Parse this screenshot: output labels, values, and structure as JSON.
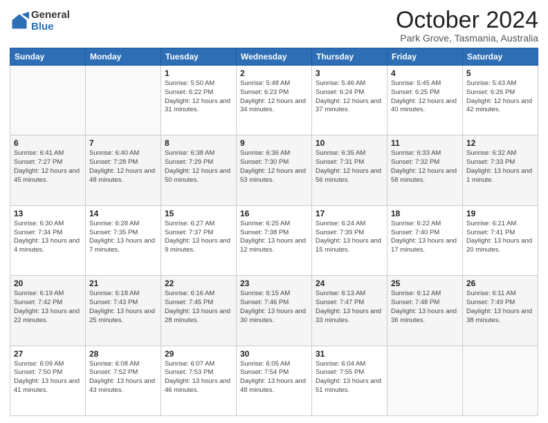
{
  "logo": {
    "general": "General",
    "blue": "Blue"
  },
  "header": {
    "month": "October 2024",
    "location": "Park Grove, Tasmania, Australia"
  },
  "weekdays": [
    "Sunday",
    "Monday",
    "Tuesday",
    "Wednesday",
    "Thursday",
    "Friday",
    "Saturday"
  ],
  "weeks": [
    [
      {
        "day": "",
        "info": ""
      },
      {
        "day": "",
        "info": ""
      },
      {
        "day": "1",
        "info": "Sunrise: 5:50 AM\nSunset: 6:22 PM\nDaylight: 12 hours and 31 minutes."
      },
      {
        "day": "2",
        "info": "Sunrise: 5:48 AM\nSunset: 6:23 PM\nDaylight: 12 hours and 34 minutes."
      },
      {
        "day": "3",
        "info": "Sunrise: 5:46 AM\nSunset: 6:24 PM\nDaylight: 12 hours and 37 minutes."
      },
      {
        "day": "4",
        "info": "Sunrise: 5:45 AM\nSunset: 6:25 PM\nDaylight: 12 hours and 40 minutes."
      },
      {
        "day": "5",
        "info": "Sunrise: 5:43 AM\nSunset: 6:26 PM\nDaylight: 12 hours and 42 minutes."
      }
    ],
    [
      {
        "day": "6",
        "info": "Sunrise: 6:41 AM\nSunset: 7:27 PM\nDaylight: 12 hours and 45 minutes."
      },
      {
        "day": "7",
        "info": "Sunrise: 6:40 AM\nSunset: 7:28 PM\nDaylight: 12 hours and 48 minutes."
      },
      {
        "day": "8",
        "info": "Sunrise: 6:38 AM\nSunset: 7:29 PM\nDaylight: 12 hours and 50 minutes."
      },
      {
        "day": "9",
        "info": "Sunrise: 6:36 AM\nSunset: 7:30 PM\nDaylight: 12 hours and 53 minutes."
      },
      {
        "day": "10",
        "info": "Sunrise: 6:35 AM\nSunset: 7:31 PM\nDaylight: 12 hours and 56 minutes."
      },
      {
        "day": "11",
        "info": "Sunrise: 6:33 AM\nSunset: 7:32 PM\nDaylight: 12 hours and 58 minutes."
      },
      {
        "day": "12",
        "info": "Sunrise: 6:32 AM\nSunset: 7:33 PM\nDaylight: 13 hours and 1 minute."
      }
    ],
    [
      {
        "day": "13",
        "info": "Sunrise: 6:30 AM\nSunset: 7:34 PM\nDaylight: 13 hours and 4 minutes."
      },
      {
        "day": "14",
        "info": "Sunrise: 6:28 AM\nSunset: 7:35 PM\nDaylight: 13 hours and 7 minutes."
      },
      {
        "day": "15",
        "info": "Sunrise: 6:27 AM\nSunset: 7:37 PM\nDaylight: 13 hours and 9 minutes."
      },
      {
        "day": "16",
        "info": "Sunrise: 6:25 AM\nSunset: 7:38 PM\nDaylight: 13 hours and 12 minutes."
      },
      {
        "day": "17",
        "info": "Sunrise: 6:24 AM\nSunset: 7:39 PM\nDaylight: 13 hours and 15 minutes."
      },
      {
        "day": "18",
        "info": "Sunrise: 6:22 AM\nSunset: 7:40 PM\nDaylight: 13 hours and 17 minutes."
      },
      {
        "day": "19",
        "info": "Sunrise: 6:21 AM\nSunset: 7:41 PM\nDaylight: 13 hours and 20 minutes."
      }
    ],
    [
      {
        "day": "20",
        "info": "Sunrise: 6:19 AM\nSunset: 7:42 PM\nDaylight: 13 hours and 22 minutes."
      },
      {
        "day": "21",
        "info": "Sunrise: 6:18 AM\nSunset: 7:43 PM\nDaylight: 13 hours and 25 minutes."
      },
      {
        "day": "22",
        "info": "Sunrise: 6:16 AM\nSunset: 7:45 PM\nDaylight: 13 hours and 28 minutes."
      },
      {
        "day": "23",
        "info": "Sunrise: 6:15 AM\nSunset: 7:46 PM\nDaylight: 13 hours and 30 minutes."
      },
      {
        "day": "24",
        "info": "Sunrise: 6:13 AM\nSunset: 7:47 PM\nDaylight: 13 hours and 33 minutes."
      },
      {
        "day": "25",
        "info": "Sunrise: 6:12 AM\nSunset: 7:48 PM\nDaylight: 13 hours and 36 minutes."
      },
      {
        "day": "26",
        "info": "Sunrise: 6:11 AM\nSunset: 7:49 PM\nDaylight: 13 hours and 38 minutes."
      }
    ],
    [
      {
        "day": "27",
        "info": "Sunrise: 6:09 AM\nSunset: 7:50 PM\nDaylight: 13 hours and 41 minutes."
      },
      {
        "day": "28",
        "info": "Sunrise: 6:08 AM\nSunset: 7:52 PM\nDaylight: 13 hours and 43 minutes."
      },
      {
        "day": "29",
        "info": "Sunrise: 6:07 AM\nSunset: 7:53 PM\nDaylight: 13 hours and 46 minutes."
      },
      {
        "day": "30",
        "info": "Sunrise: 6:05 AM\nSunset: 7:54 PM\nDaylight: 13 hours and 48 minutes."
      },
      {
        "day": "31",
        "info": "Sunrise: 6:04 AM\nSunset: 7:55 PM\nDaylight: 13 hours and 51 minutes."
      },
      {
        "day": "",
        "info": ""
      },
      {
        "day": "",
        "info": ""
      }
    ]
  ],
  "row_shades": [
    "white",
    "shade",
    "white",
    "shade",
    "white"
  ]
}
